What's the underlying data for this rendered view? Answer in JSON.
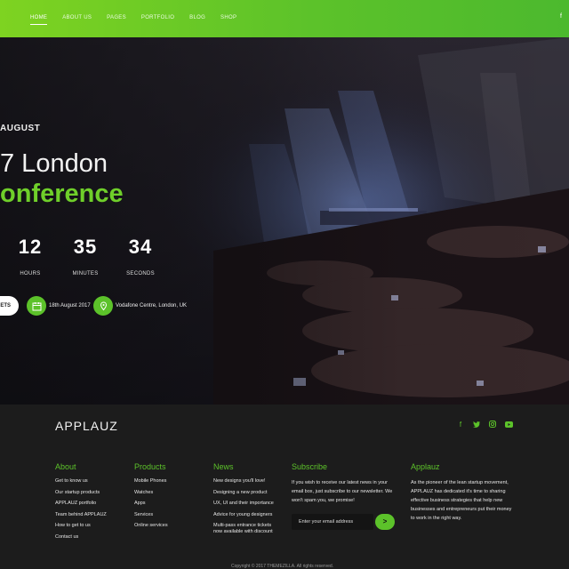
{
  "nav": {
    "items": [
      {
        "label": "HOME",
        "active": true
      },
      {
        "label": "ABOUT US",
        "active": false
      },
      {
        "label": "PAGES",
        "active": false
      },
      {
        "label": "PORTFOLIO",
        "active": false
      },
      {
        "label": "BLOG",
        "active": false
      },
      {
        "label": "SHOP",
        "active": false
      }
    ],
    "social_icon": "f"
  },
  "hero": {
    "date_line": "AUGUST",
    "title_line1": "7 London",
    "title_line2": "onference",
    "countdown": [
      {
        "value": "12",
        "label": "HOURS"
      },
      {
        "value": "35",
        "label": "MINUTES"
      },
      {
        "value": "34",
        "label": "SECONDS"
      }
    ],
    "tickets_label": "ETS",
    "date_text": "18th August 2017",
    "venue_text": "Vodafone Centre, London, UK",
    "accent": "#5cc22a"
  },
  "footer": {
    "logo": "APPLAUZ",
    "socials": [
      "facebook-icon",
      "twitter-icon",
      "instagram-icon",
      "youtube-icon"
    ],
    "about": {
      "heading": "About",
      "items": [
        "Get to know us",
        "Our startup products",
        "APPLAUZ portfolio",
        "Team behind APPLAUZ",
        "How to get to us",
        "Contact us"
      ]
    },
    "products": {
      "heading": "Products",
      "items": [
        "Mobile Phones",
        "Watches",
        "Apps",
        "Services",
        "Online services"
      ]
    },
    "news": {
      "heading": "News",
      "items": [
        "New designs you'll love!",
        "Designing a new product",
        "UX, UI and their importance",
        "Advice for young designers",
        "Multi-pass entrance tickets",
        "now available with discount"
      ]
    },
    "subscribe": {
      "heading": "Subscribe",
      "text": "If you wish to receive our latest news in your email box, just subscribe to our newsletter. We won't spam you, we promise!",
      "placeholder": "Enter your email address",
      "button": ">"
    },
    "applauz": {
      "heading": "Applauz",
      "text": "As the pioneer of the lean startup movement, APPLAUZ has dedicated it's time to sharing effective business strategies that help new businesses and entrepreneurs put their money to work in the right way."
    },
    "copyright": "Copyright © 2017 THEMEZILLA. All rights reserved."
  }
}
